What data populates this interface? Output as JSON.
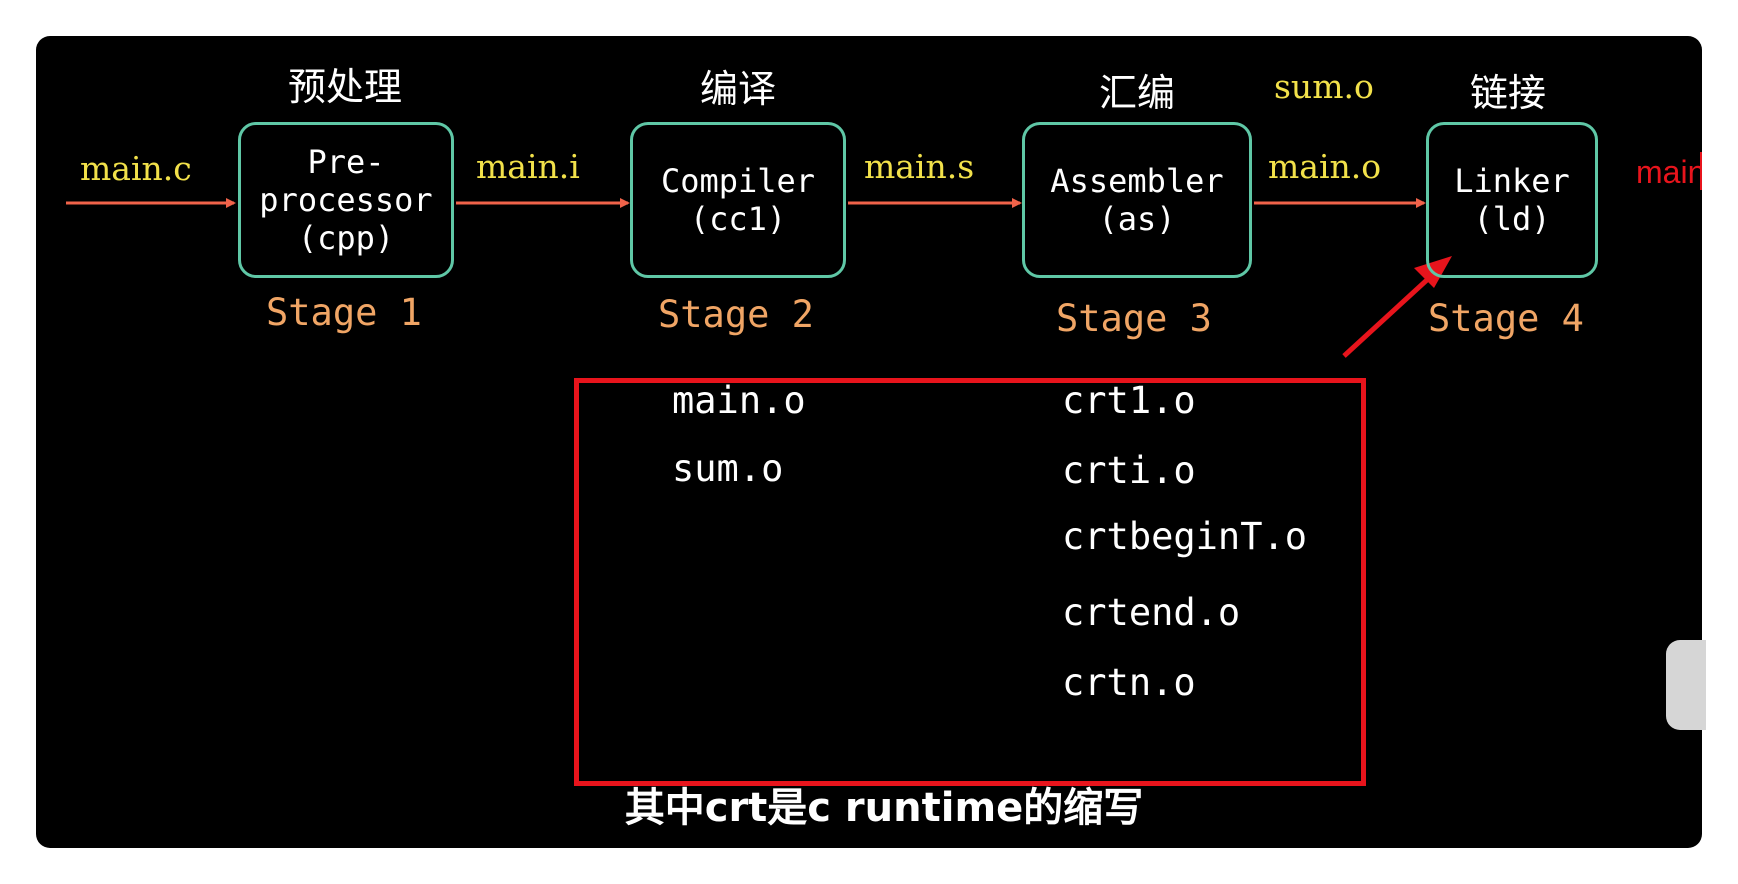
{
  "stages_cn": [
    "预处理",
    "编译",
    "汇编",
    "链接"
  ],
  "extra_input": "sum.o",
  "files": {
    "input": "main.c",
    "after_preprocess": "main.i",
    "after_compile": "main.s",
    "after_assemble": "main.o"
  },
  "boxes": [
    {
      "lines": [
        "Pre-",
        "processor",
        "(cpp)"
      ]
    },
    {
      "lines": [
        "Compiler",
        "(cc1)"
      ]
    },
    {
      "lines": [
        "Assembler",
        "(as)"
      ]
    },
    {
      "lines": [
        "Linker",
        "(ld)"
      ]
    }
  ],
  "stage_labels": [
    "Stage 1",
    "Stage 2",
    "Stage 3",
    "Stage 4"
  ],
  "output_label": "main",
  "link_objects": {
    "left": [
      "main.o",
      "sum.o"
    ],
    "right": [
      "crt1.o",
      "crti.o",
      "crtbeginT.o",
      "crtend.o",
      "crtn.o"
    ]
  },
  "subtitle": "其中crt是c runtime的缩写",
  "colors": {
    "background": "#000000",
    "box_border": "#5fc7a6",
    "arrow": "#f0634a",
    "file_label": "#f2e14a",
    "stage_label": "#f0a565",
    "highlight": "#e8141c"
  }
}
